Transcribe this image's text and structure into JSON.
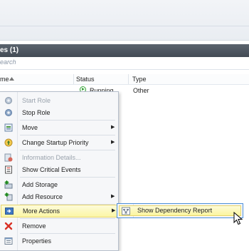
{
  "panel": {
    "title": "es (1)",
    "search_placeholder": "earch"
  },
  "table": {
    "columns": [
      "me",
      "Status",
      "Type"
    ],
    "rows": [
      {
        "status": "Running",
        "type": "Other"
      }
    ]
  },
  "context_menu": {
    "items": [
      {
        "label": "Start Role",
        "icon": "start-role-icon",
        "disabled": true
      },
      {
        "label": "Stop Role",
        "icon": "stop-role-icon",
        "disabled": false
      },
      {
        "label": "Move",
        "icon": "move-icon",
        "submenu": true
      },
      {
        "label": "Change Startup Priority",
        "icon": "priority-icon",
        "submenu": true
      },
      {
        "label": "Information Details...",
        "icon": "information-icon",
        "disabled": true
      },
      {
        "label": "Show Critical Events",
        "icon": "critical-events-icon"
      },
      {
        "label": "Add Storage",
        "icon": "add-storage-icon"
      },
      {
        "label": "Add Resource",
        "icon": "add-resource-icon",
        "submenu": true
      },
      {
        "label": "More Actions",
        "icon": "more-actions-icon",
        "submenu": true,
        "highlighted": true
      },
      {
        "label": "Remove",
        "icon": "remove-icon"
      },
      {
        "label": "Properties",
        "icon": "properties-icon"
      }
    ]
  },
  "submenu": {
    "label": "Show Dependency Report",
    "icon": "dependency-report-icon"
  },
  "colors": {
    "titlebar": "#4b535d",
    "highlight": "#fbf6a5",
    "highlight_border": "#e6d46c",
    "submenu_border": "#4d8fd8",
    "running_green": "#3aa53a",
    "remove_red": "#d93025"
  }
}
